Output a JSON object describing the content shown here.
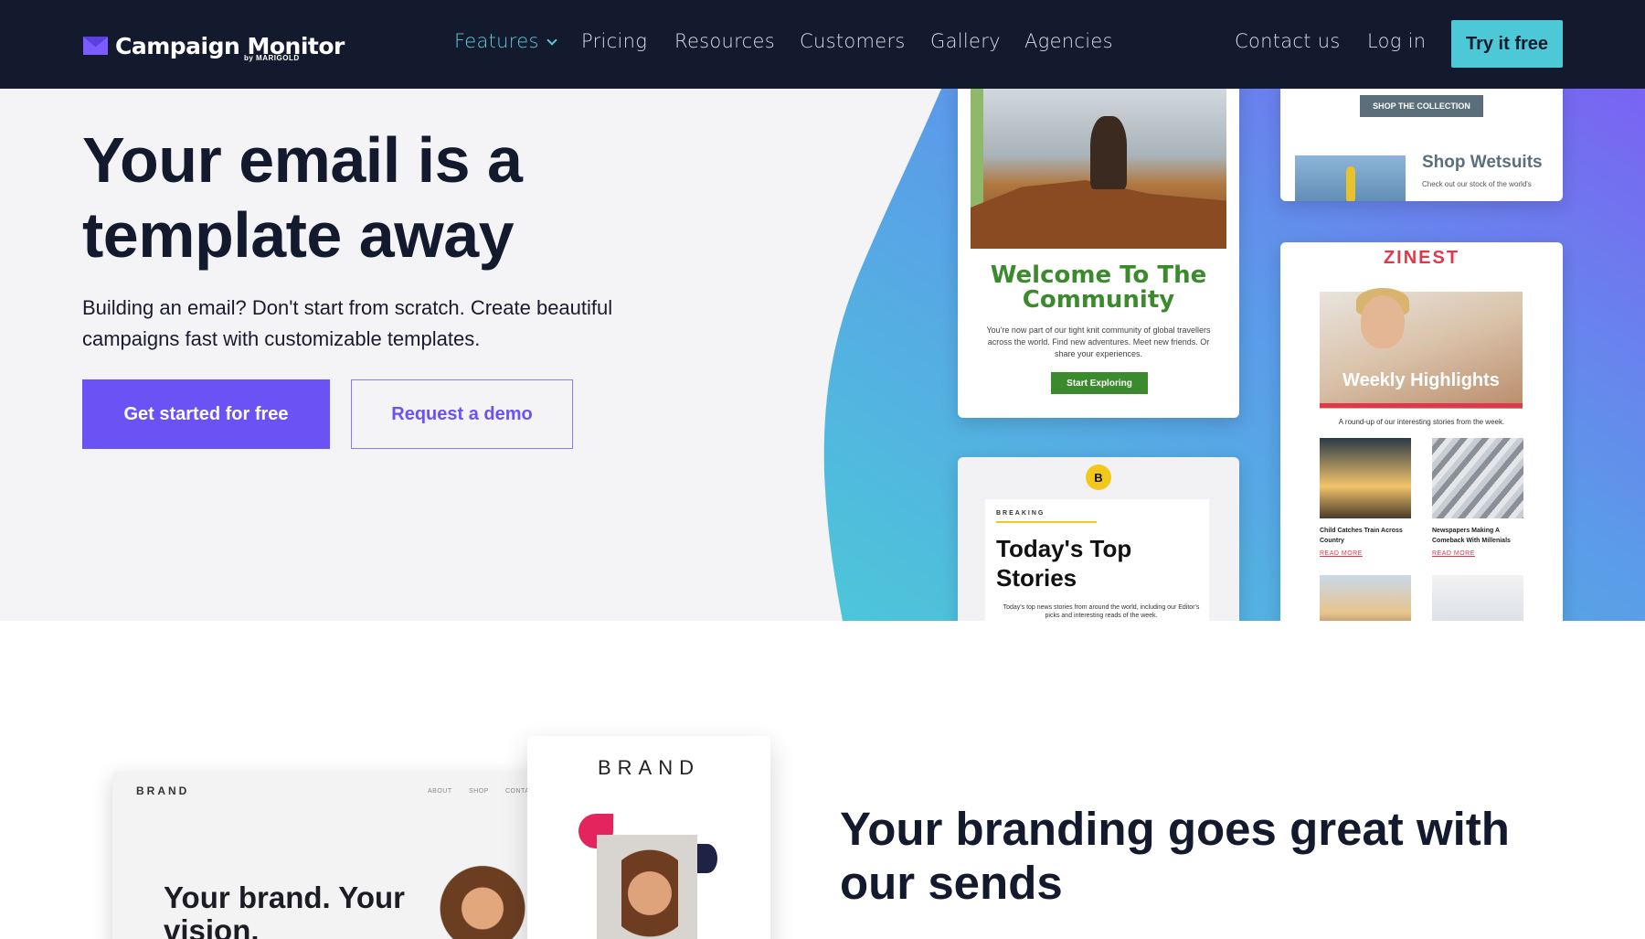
{
  "nav": {
    "logo_text": "Campaign Monitor",
    "logo_sub": "by MARIGOLD",
    "links": [
      "Features",
      "Pricing",
      "Resources",
      "Customers",
      "Gallery",
      "Agencies"
    ],
    "right_links": [
      "Contact us",
      "Log in"
    ],
    "cta": "Try it free",
    "colors": {
      "background": "#141a2e",
      "accent": "#5ec9d9",
      "cta_bg": "#4dc8d6"
    }
  },
  "hero": {
    "title": "Your email is a template away",
    "subtitle": "Building an email? Don't start from scratch. Create beautiful campaigns fast with customizable templates.",
    "primary_button": "Get started for free",
    "secondary_button": "Request a demo",
    "colors": {
      "primary": "#6a52f5"
    }
  },
  "templates": {
    "welcome": {
      "title": "Welcome To The Community",
      "body": "You're now part of our tight knit community of global travellers across the world. Find new adventures. Meet new friends. Or share your experiences.",
      "cta": "Start Exploring"
    },
    "wetsuit": {
      "shop_button": "SHOP THE COLLECTION",
      "title": "Shop Wetsuits",
      "sub": "Check out our stock of the world's"
    },
    "zinest": {
      "brand": "ZINEST",
      "feature_title": "Weekly Highlights",
      "feature_sub": "A round-up of our interesting stories from the week.",
      "story1": "Child Catches Train Across Country",
      "story2": "Newspapers Making A Comeback With Millenials",
      "read_more": "READ MORE"
    },
    "news": {
      "badge": "B",
      "kicker": "BREAKING",
      "title": "Today's Top Stories",
      "body": "Today's top news stories from around the world, including our Editor's picks and interesting reads of the week."
    }
  },
  "section2": {
    "title": "Your branding goes great with our sends",
    "site_mock": {
      "brand": "BRAND",
      "menu": [
        "ABOUT",
        "SHOP",
        "CONTA"
      ],
      "headline": "Your brand. Your vision."
    },
    "email_mock": {
      "brand": "BRAND"
    }
  }
}
